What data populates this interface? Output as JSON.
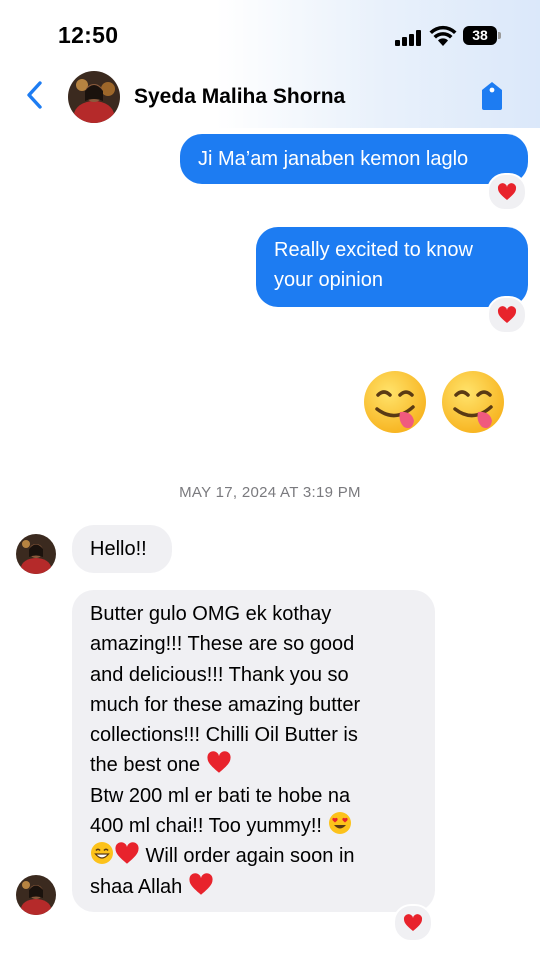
{
  "status_bar": {
    "time": "12:50",
    "battery": "38"
  },
  "header": {
    "contact_name": "Syeda Maliha Shorna"
  },
  "messages": {
    "out1": "Ji Ma’am janaben kemon laglo",
    "out2": "Really excited to know your opinion",
    "timestamp": "MAY 17, 2024 AT 3:19 PM",
    "in1": "Hello!!",
    "in2": {
      "l1": "Butter gulo OMG ek kothay",
      "l2": "amazing!!! These are so good",
      "l3": "and delicious!!! Thank you so",
      "l4": "much for these amazing butter",
      "l5": "collections!!! Chilli Oil Butter is",
      "l6": "the best one",
      "l7": "Btw 200 ml er bati te hobe na",
      "l8": "400 ml chai!! Too yummy!!",
      "l9": " Will order again soon in",
      "l10": "shaa Allah"
    }
  },
  "icons": [
    "back-chevron-icon",
    "tag-icon",
    "heart-icon",
    "yum-face-emoji",
    "heart-eyes-emoji",
    "grin-emoji"
  ],
  "colors": {
    "accent": "#1d7cf2",
    "incoming_bubble": "#f0f0f3",
    "heart": "#e8232c"
  }
}
